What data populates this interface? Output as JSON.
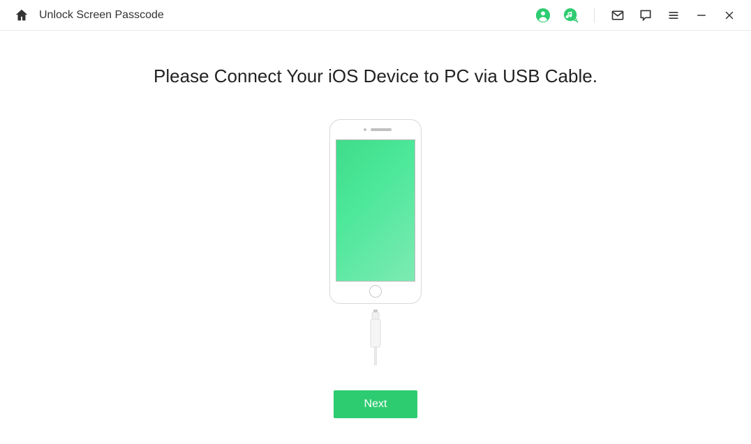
{
  "header": {
    "title": "Unlock Screen Passcode"
  },
  "main": {
    "heading": "Please Connect Your iOS Device to PC via USB Cable.",
    "next_label": "Next"
  },
  "colors": {
    "accent": "#2ecc71"
  }
}
